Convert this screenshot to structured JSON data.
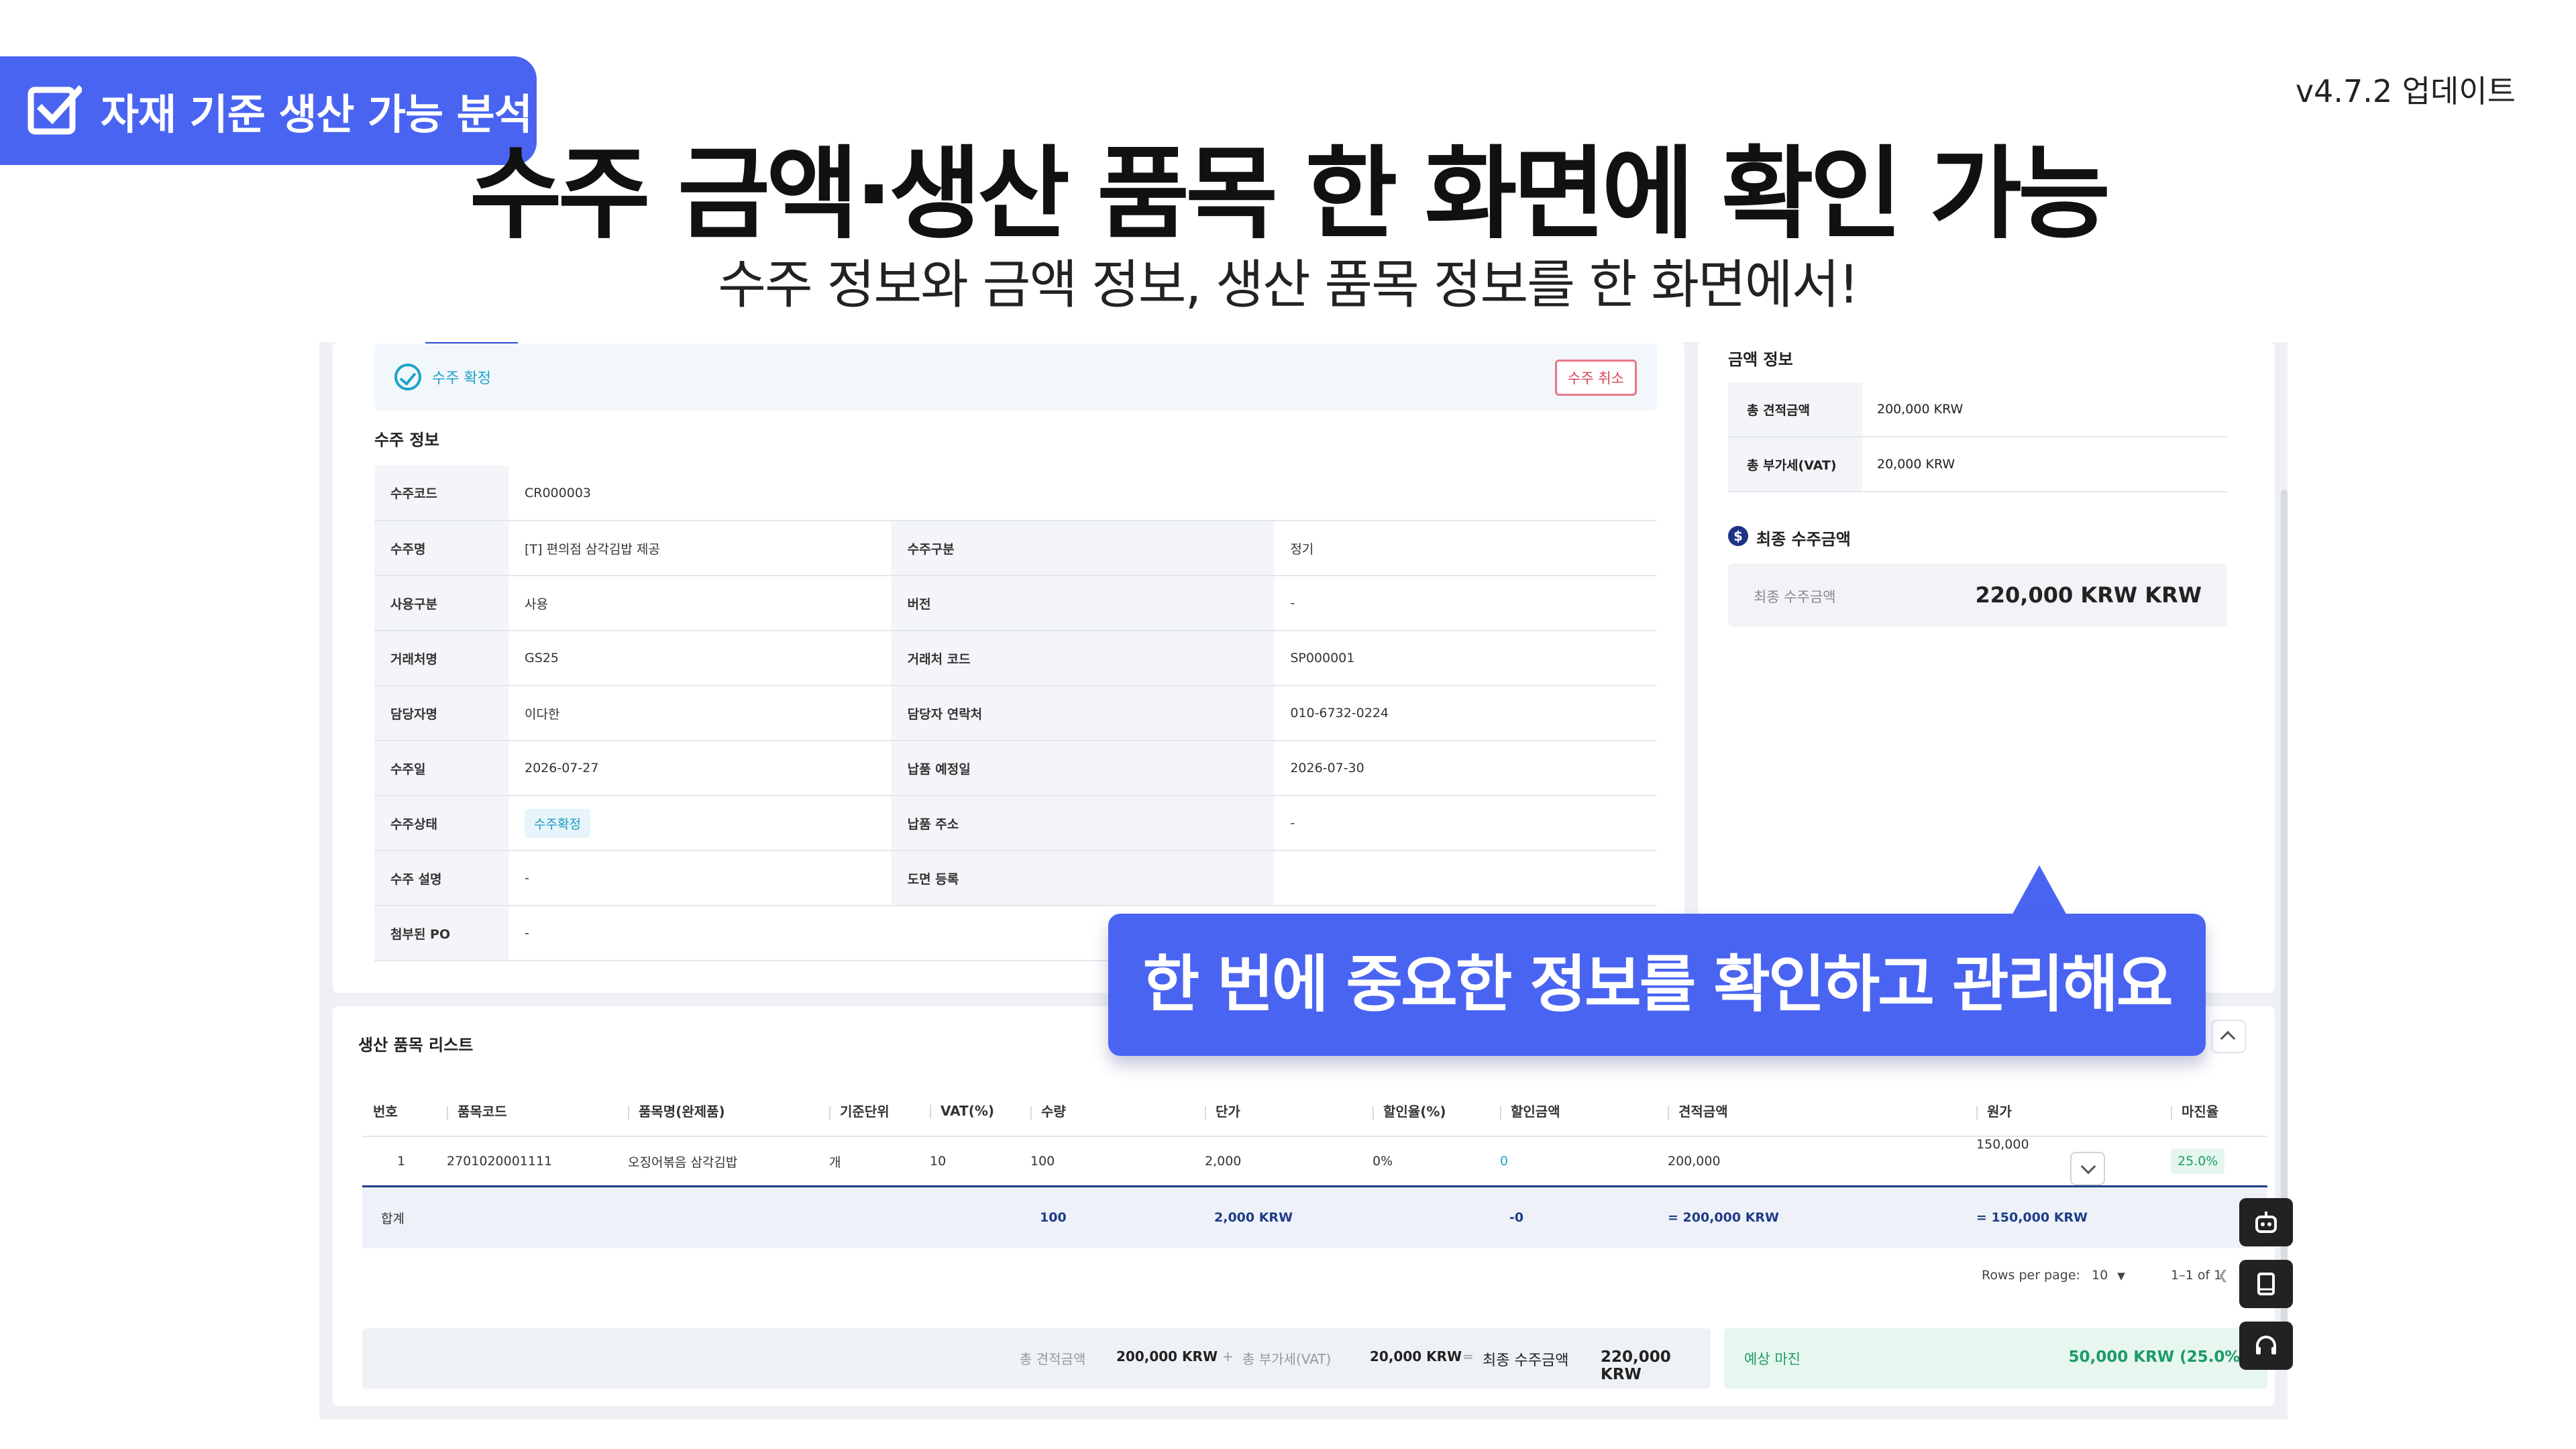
{
  "promo": {
    "badge": "자재 기준 생산 가능 분석",
    "version": "v4.7.2 업데이트",
    "headline": "수주 금액·생산 품목 한 화면에 확인 가능",
    "subline": "수주 정보와 금액 정보, 생산 품목 정보를 한 화면에서!",
    "callout": "한 번에 중요한 정보를 확인하고 관리해요"
  },
  "status": {
    "label": "수주 확정",
    "cancel_label": "수주 취소"
  },
  "order_info": {
    "title": "수주 정보",
    "code_label": "수주코드",
    "code": "CR000003",
    "name_label": "수주명",
    "name": "[T] 편의점 삼각김밥 제공",
    "type_label": "수주구분",
    "type": "정기",
    "use_label": "사용구분",
    "use": "사용",
    "version_label": "버전",
    "version": "-",
    "client_label": "거래처명",
    "client": "GS25",
    "client_code_label": "거래처 코드",
    "client_code": "SP000001",
    "manager_label": "담당자명",
    "manager": "이다한",
    "manager_phone_label": "담당자 연락처",
    "manager_phone": "010-6732-0224",
    "order_date_label": "수주일",
    "order_date": "2026-07-27",
    "delivery_date_label": "납품 예정일",
    "delivery_date": "2026-07-30",
    "state_label": "수주상태",
    "state": "수주확정",
    "delivery_addr_label": "납품 주소",
    "delivery_addr": "-",
    "desc_label": "수주 설명",
    "desc": "-",
    "drawing_label": "도면 등록",
    "drawing": "",
    "po_label": "첨부된 PO",
    "po": "-"
  },
  "amount_info": {
    "title": "금액 정보",
    "total_est_label": "총 견적금액",
    "total_est": "200,000 KRW",
    "total_vat_label": "총 부가세(VAT)",
    "total_vat": "20,000 KRW",
    "final_title": "최종 수주금액",
    "final_label": "최종 수주금액",
    "final_value": "220,000 KRW KRW"
  },
  "product_list": {
    "title": "생산 품목 리스트",
    "columns": [
      "번호",
      "품목코드",
      "품목명(완제품)",
      "기준단위",
      "VAT(%)",
      "수량",
      "단가",
      "할인율(%)",
      "할인금액",
      "견적금액",
      "원가",
      "마진율"
    ],
    "row": {
      "no": "1",
      "code": "2701020001111",
      "name": "오징어볶음 삼각김밥",
      "unit": "개",
      "vat": "10",
      "qty": "100",
      "price": "2,000",
      "discount_rate": "0%",
      "discount_amt": "0",
      "estimate": "200,000",
      "cost": "150,000",
      "margin": "25.0%"
    },
    "sum": {
      "label": "합계",
      "qty": "100",
      "price": "2,000 KRW",
      "discount_amt": "-0",
      "estimate": "= 200,000 KRW",
      "cost": "= 150,000 KRW"
    },
    "pager": {
      "rows_label": "Rows per page:",
      "rows_value": "10",
      "range": "1–1 of 1"
    }
  },
  "totals": {
    "est_label": "총 견적금액",
    "est": "200,000 KRW",
    "plus": "+",
    "vat_label": "총 부가세(VAT)",
    "vat": "20,000 KRW",
    "eq": "=",
    "final_label": "최종 수주금액",
    "final": "220,000 KRW",
    "margin_label": "예상 마진",
    "margin": "50,000 KRW (25.0%)"
  },
  "icons": {
    "badge": "checkbox-icon",
    "status": "check-circle-icon",
    "dollar": "dollar-icon",
    "collapse": "chevron-up-icon",
    "float1": "robot-icon",
    "float2": "book-icon",
    "float3": "headset-icon"
  },
  "colors": {
    "accent": "#4a64f2",
    "navy": "#1f3c88",
    "teal": "#1aa3c6",
    "green": "#1d9b68",
    "danger": "#d9455c"
  }
}
